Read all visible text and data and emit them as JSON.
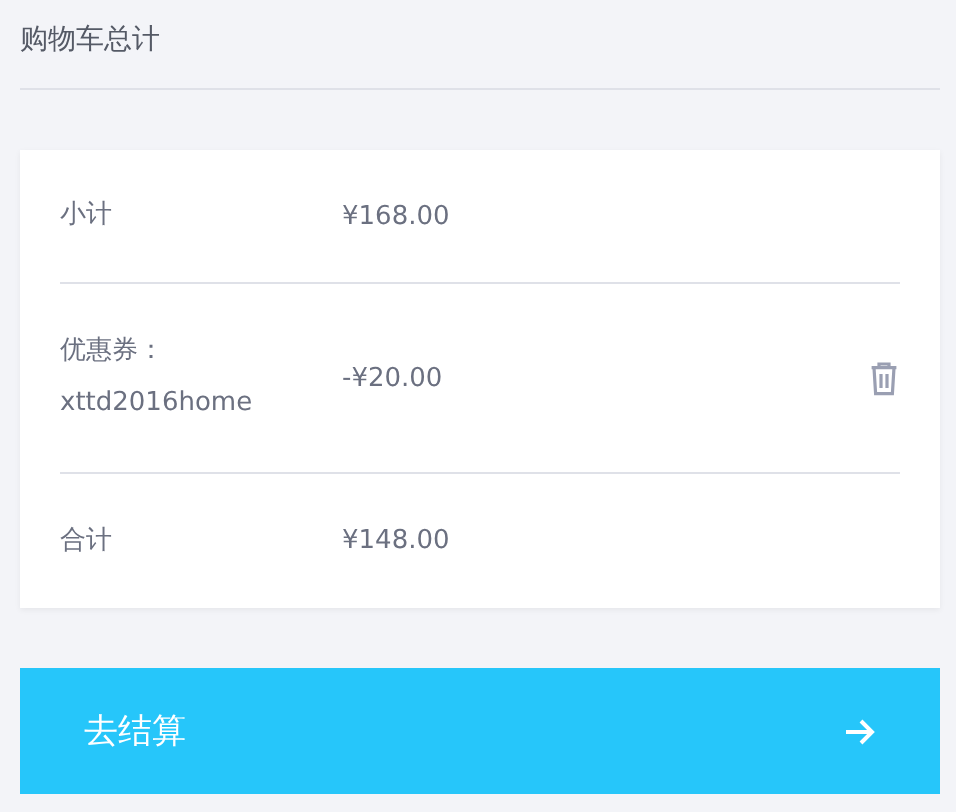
{
  "title": "购物车总计",
  "rows": [
    {
      "label": "小计",
      "value": "¥168.00",
      "deletable": false
    },
    {
      "label": "优惠券：",
      "code": "xttd2016home",
      "value": "-¥20.00",
      "deletable": true
    },
    {
      "label": "合计",
      "value": "¥148.00",
      "deletable": false
    }
  ],
  "checkout": {
    "label": "去结算"
  }
}
